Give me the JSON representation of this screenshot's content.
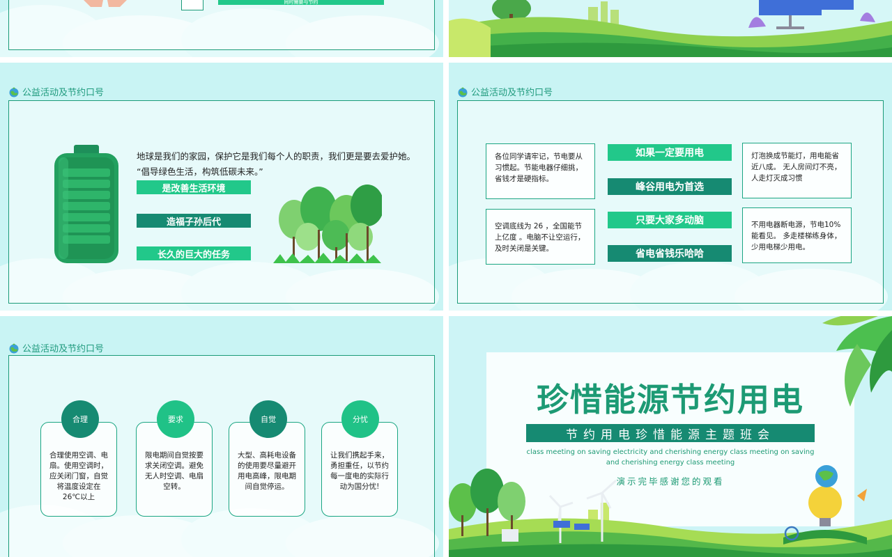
{
  "colors": {
    "slide_bg": "#c9f4f4",
    "dark_green": "#168a72",
    "light_green": "#22c88a",
    "frame": "#1a9a78"
  },
  "slide1": {
    "caption_partial": "同时需要与节约"
  },
  "section_title": "公益活动及节约口号",
  "slide3": {
    "paragraph_line1": "地球是我们的家园，保护它是我们每个人的职责，我们更是要去爱护她。",
    "paragraph_line2": "“倡导绿色生活，构筑低碳未来。”",
    "bars": [
      "是改善生活环境",
      "造福子孙后代",
      "长久的巨大的任务"
    ]
  },
  "slide4": {
    "left_boxes": [
      "各位同学请牢记，节电要从习惯起。节能电器仔细挑，省钱才是硬指标。",
      "空调底线为 26 ，全国能节上亿度 。电脑不让空运行，及时关闭是关键。"
    ],
    "bars": [
      "如果一定要用电",
      "峰谷用电为首选",
      "只要大家多动脑",
      "省电省钱乐哈哈"
    ],
    "right_boxes": [
      "灯泡换成节能灯，用电能省近八成。 无人房间灯不亮，人走灯灭成习惯",
      "不用电器断电源，节电10%能看见。 多走楼梯练身体，少用电梯少用电。"
    ]
  },
  "slide5": {
    "pillars": [
      {
        "title": "合理",
        "text": "合理使用空调、电扇。使用空调时，应关闭门窗，自觉将温度设定在26℃以上"
      },
      {
        "title": "要求",
        "text": "限电期间自觉按要求关闭空调。避免无人时空调、电扇空转。"
      },
      {
        "title": "自觉",
        "text": "大型、高耗电设备的使用要尽量避开用电高峰，限电期间自觉停运。"
      },
      {
        "title": "分忧",
        "text": "让我们携起手来，勇担重任，以节约每一度电的实际行动为国分忧!"
      }
    ]
  },
  "slide6": {
    "main_title": "珍惜能源节约用电",
    "subtitle": "节约用电珍惜能源主题班会",
    "english_line1": "class meeting on saving electricity and cherishing energy class meeting on saving",
    "english_line2": "and cherishing energy class meeting",
    "thanks": "演示完毕感谢您的观看"
  }
}
